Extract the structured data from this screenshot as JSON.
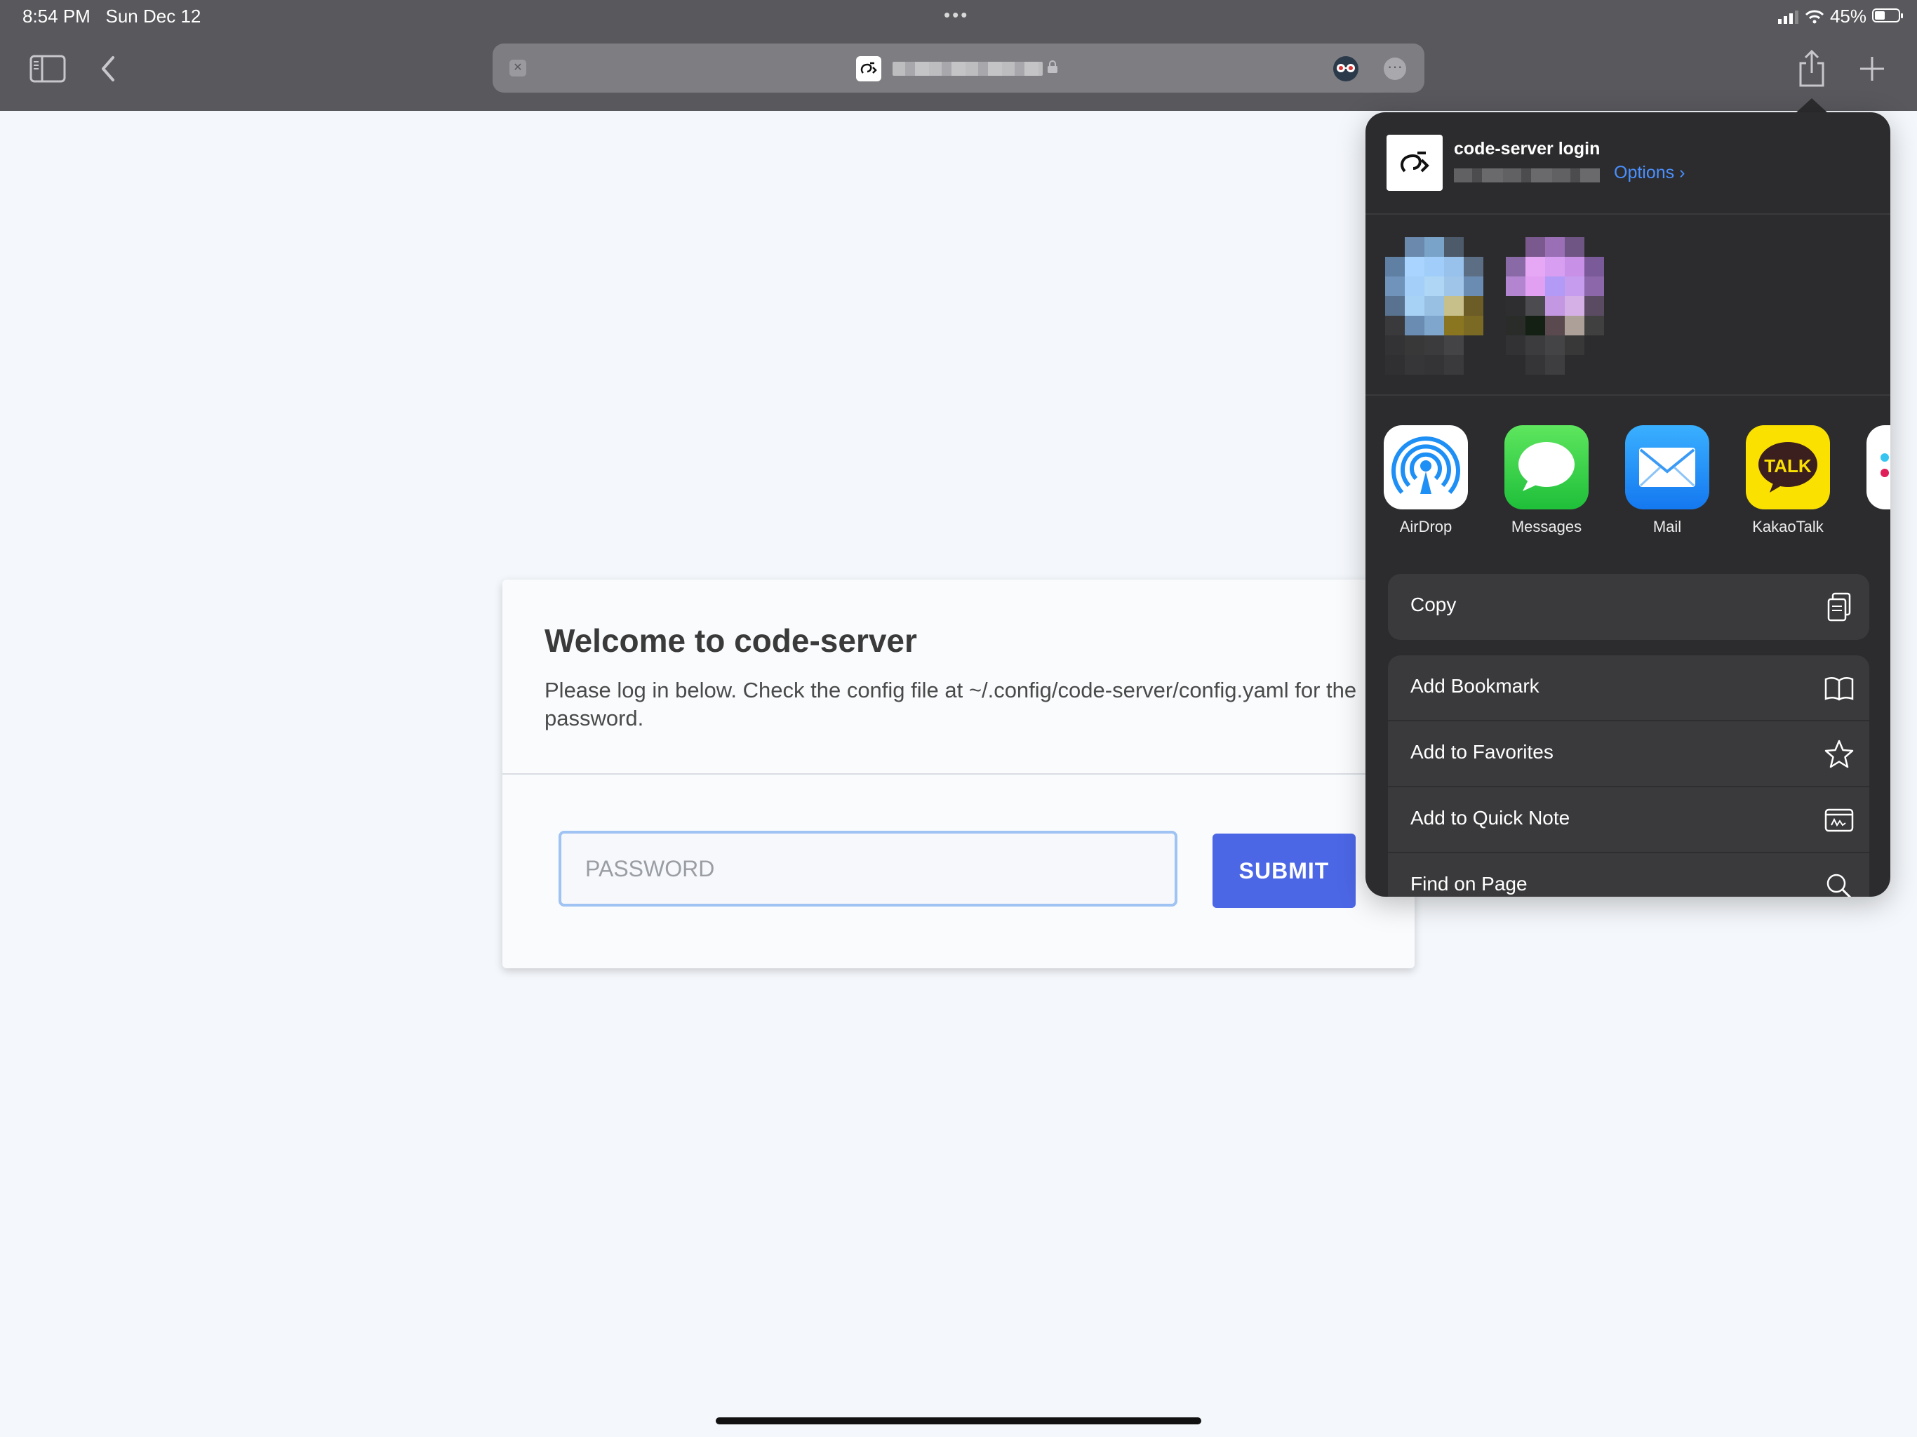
{
  "status_bar": {
    "time": "8:54 PM",
    "date": "Sun Dec 12",
    "battery": "45%"
  },
  "browser": {
    "tab_close_glyph": "✕",
    "more_glyph": "···",
    "icons": [
      "sidebar-icon",
      "back-chevron-icon",
      "share-icon",
      "new-tab-plus-icon",
      "lock-icon",
      "extension-icon"
    ]
  },
  "login": {
    "title": "Welcome to code-server",
    "description": "Please log in below. Check the config file at ~/.config/code-server/config.yaml for the password.",
    "password_placeholder": "PASSWORD",
    "submit_label": "SUBMIT"
  },
  "share_sheet": {
    "title": "code-server login",
    "options_label": "Options ›",
    "apps": [
      {
        "label": "AirDrop",
        "icon": "airdrop-icon"
      },
      {
        "label": "Messages",
        "icon": "messages-icon"
      },
      {
        "label": "Mail",
        "icon": "mail-icon"
      },
      {
        "label": "KakaoTalk",
        "icon": "kakaotalk-icon",
        "badge_text": "TALK"
      }
    ],
    "actions_primary": [
      {
        "label": "Copy",
        "icon": "copy-icon"
      }
    ],
    "actions_secondary": [
      {
        "label": "Add Bookmark",
        "icon": "book-icon"
      },
      {
        "label": "Add to Favorites",
        "icon": "star-icon"
      },
      {
        "label": "Add to Quick Note",
        "icon": "quick-note-icon"
      },
      {
        "label": "Find on Page",
        "icon": "magnifier-icon"
      }
    ]
  },
  "colors": {
    "chrome": "#58585d",
    "page_bg": "#f4f7fb",
    "submit": "#4c67e6",
    "input_border": "#9fc3f2",
    "sheet_bg": "#2c2c2e",
    "link": "#4a90ff"
  }
}
